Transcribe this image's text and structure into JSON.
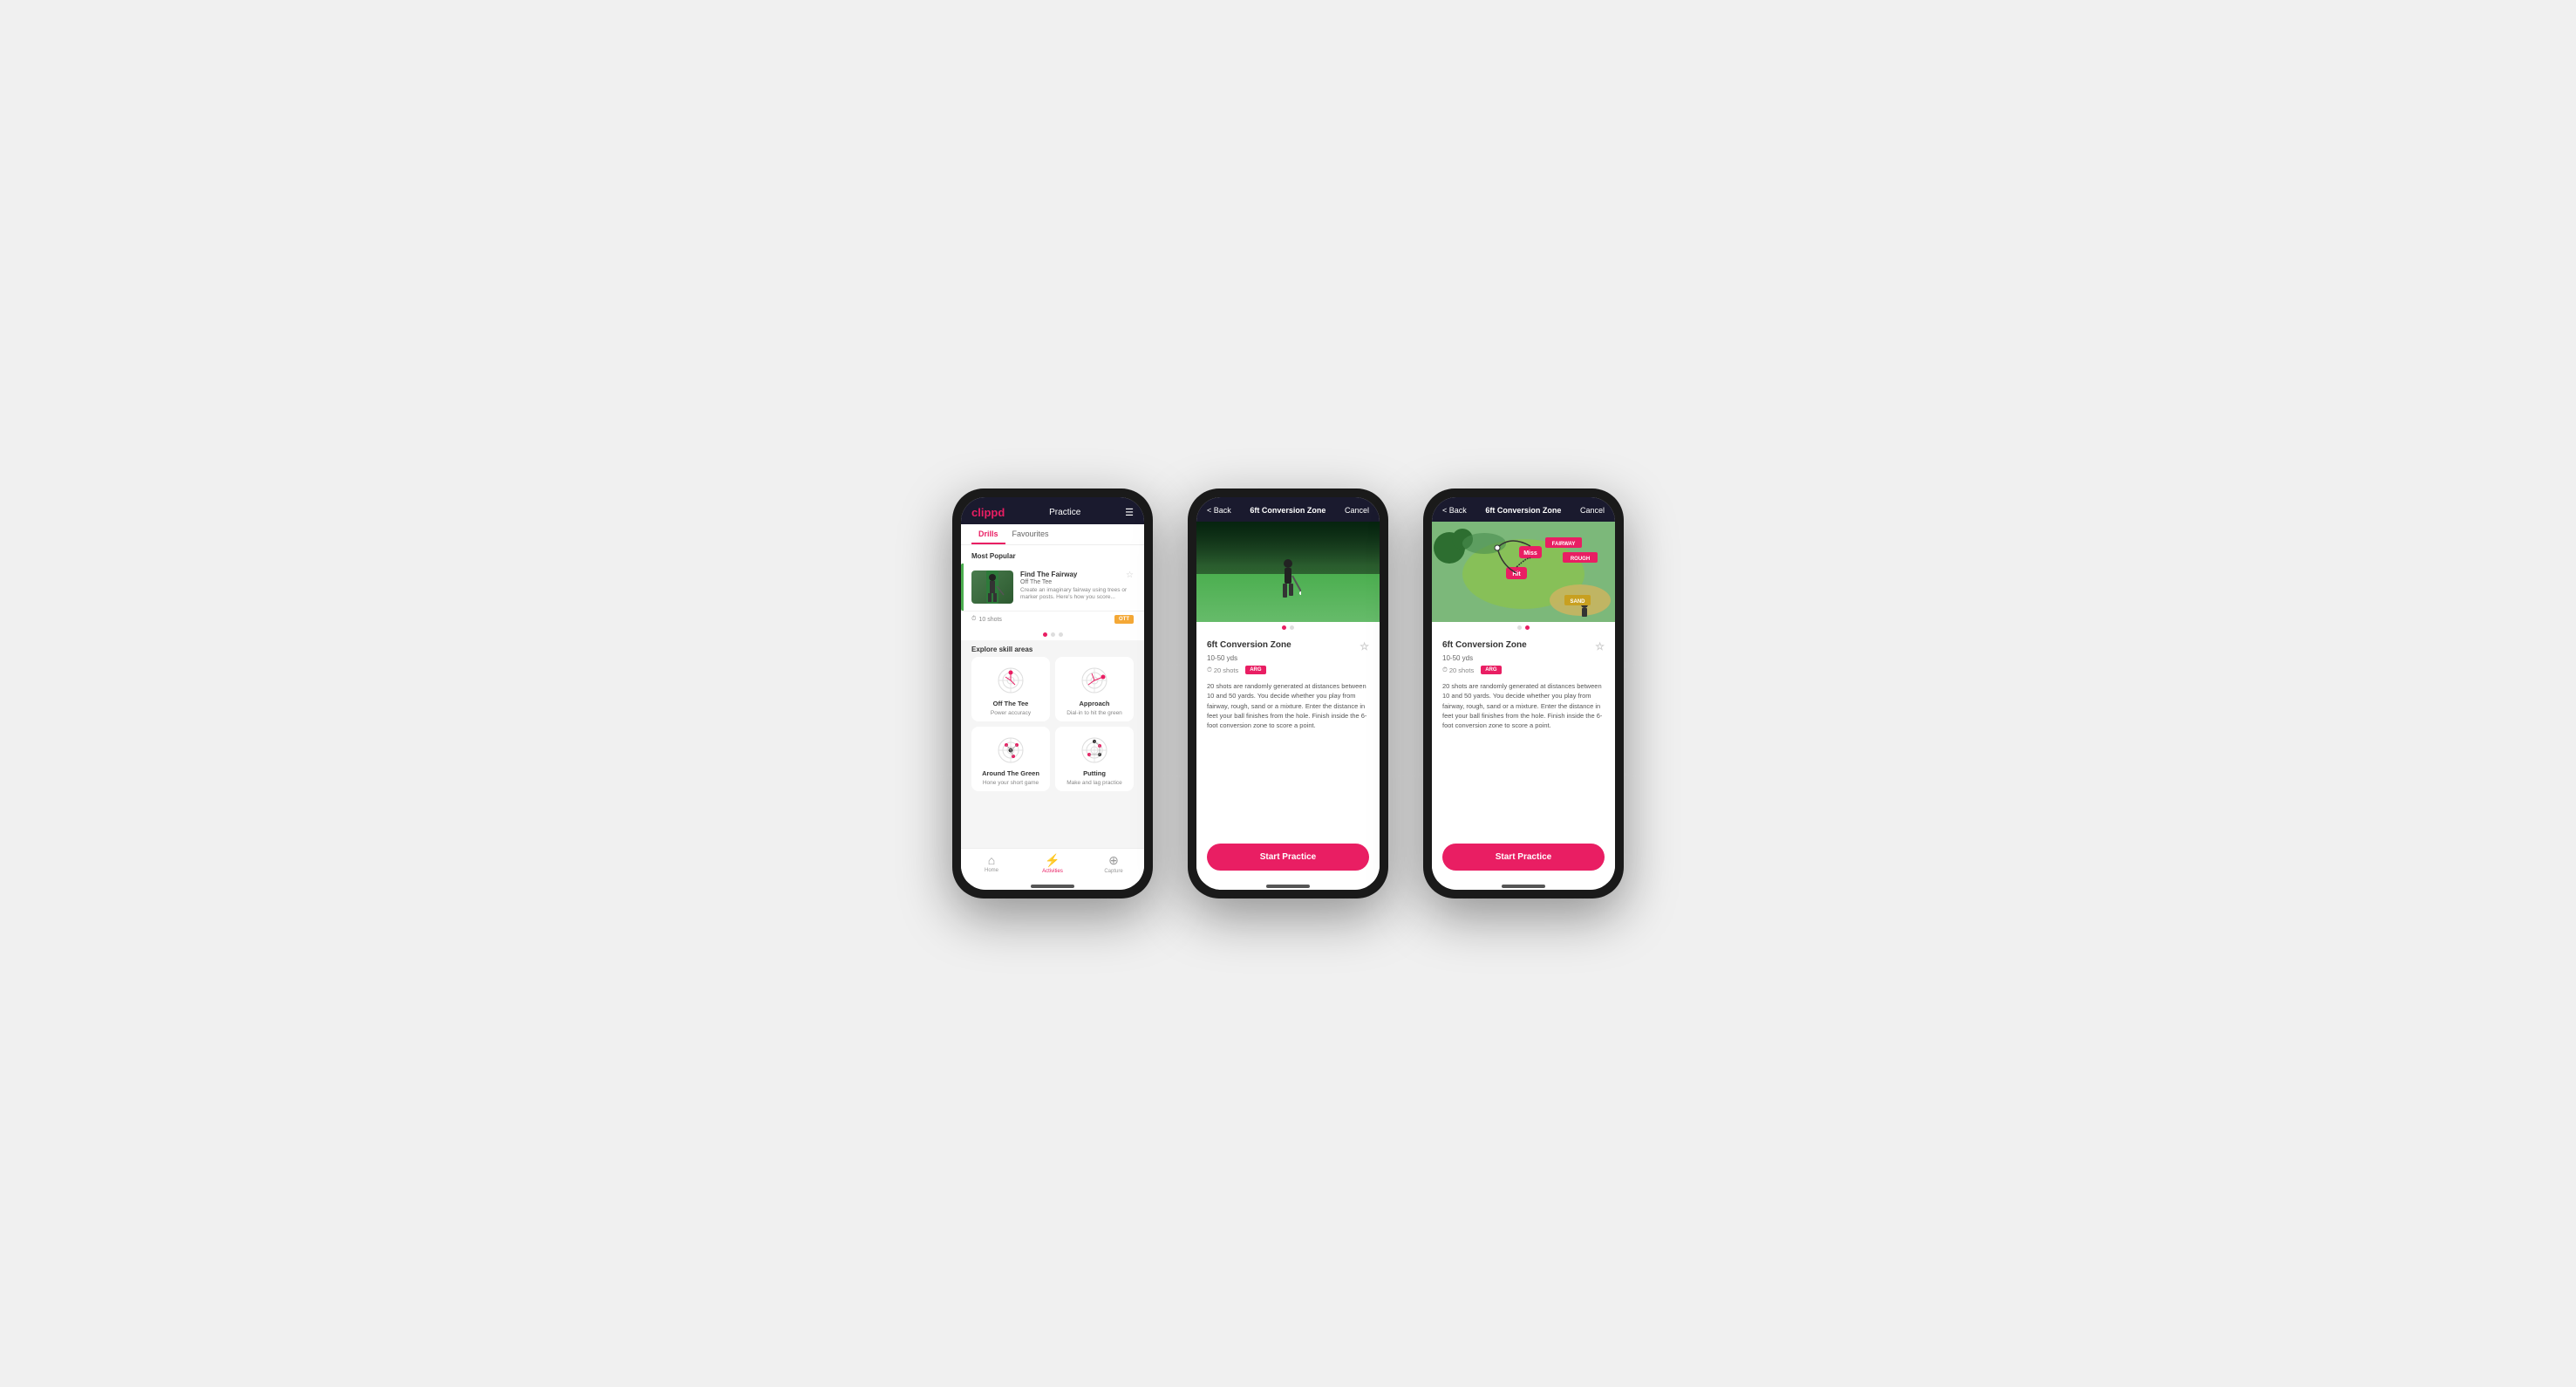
{
  "phone1": {
    "header": {
      "logo": "clippd",
      "title": "Practice",
      "menu_icon": "☰"
    },
    "tabs": [
      {
        "label": "Drills",
        "active": true
      },
      {
        "label": "Favourites",
        "active": false
      }
    ],
    "most_popular": {
      "section_title": "Most Popular",
      "card": {
        "name": "Find The Fairway",
        "sub": "Off The Tee",
        "description": "Create an imaginary fairway using trees or marker posts. Here's how you score...",
        "shots": "10 shots",
        "badge": "OTT"
      },
      "dots": [
        true,
        false,
        false
      ]
    },
    "explore": {
      "section_title": "Explore skill areas",
      "items": [
        {
          "name": "Off The Tee",
          "desc": "Power accuracy"
        },
        {
          "name": "Approach",
          "desc": "Dial-in to hit the green"
        },
        {
          "name": "Around The Green",
          "desc": "Hone your short game"
        },
        {
          "name": "Putting",
          "desc": "Make and lag practice"
        }
      ]
    },
    "bottom_nav": [
      {
        "label": "Home",
        "icon": "⌂",
        "active": false
      },
      {
        "label": "Activities",
        "icon": "⚡",
        "active": true
      },
      {
        "label": "Capture",
        "icon": "⊕",
        "active": false
      }
    ]
  },
  "phone2": {
    "header": {
      "back_label": "< Back",
      "title": "6ft Conversion Zone",
      "cancel_label": "Cancel"
    },
    "dots": [
      true,
      false
    ],
    "drill": {
      "title": "6ft Conversion Zone",
      "range": "10-50 yds",
      "shots": "20 shots",
      "badge": "ARG",
      "description": "20 shots are randomly generated at distances between 10 and 50 yards. You decide whether you play from fairway, rough, sand or a mixture. Enter the distance in feet your ball finishes from the hole. Finish inside the 6-foot conversion zone to score a point."
    },
    "start_button": "Start Practice"
  },
  "phone3": {
    "header": {
      "back_label": "< Back",
      "title": "6ft Conversion Zone",
      "cancel_label": "Cancel"
    },
    "dots": [
      false,
      true
    ],
    "drill": {
      "title": "6ft Conversion Zone",
      "range": "10-50 yds",
      "shots": "20 shots",
      "badge": "ARG",
      "description": "20 shots are randomly generated at distances between 10 and 50 yards. You decide whether you play from fairway, rough, sand or a mixture. Enter the distance in feet your ball finishes from the hole. Finish inside the 6-foot conversion zone to score a point."
    },
    "start_button": "Start Practice"
  }
}
